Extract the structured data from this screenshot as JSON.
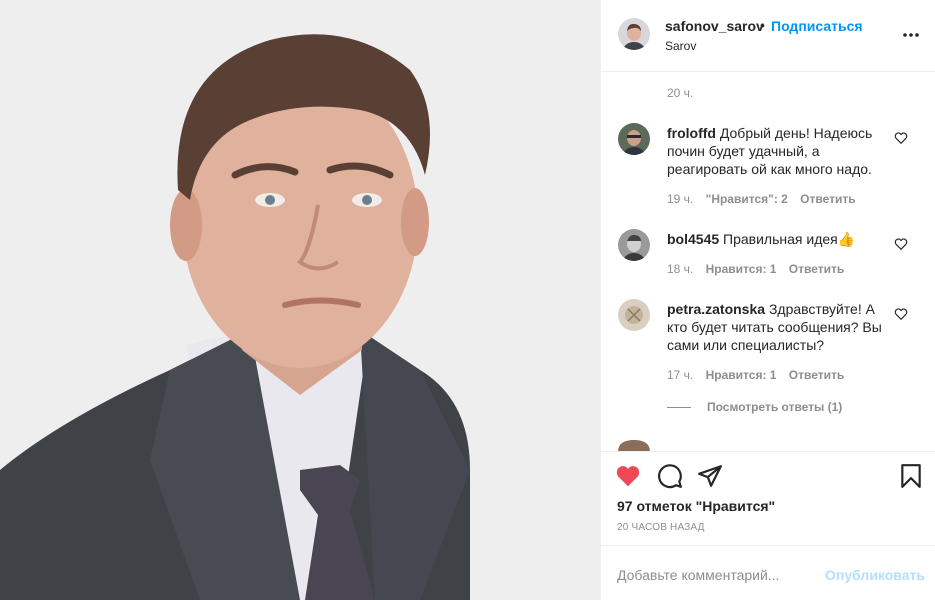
{
  "post": {
    "username": "safonov_sarov",
    "follow_label": "Подписаться",
    "location": "Sarov",
    "caption_time": "20 ч."
  },
  "comments": [
    {
      "user": "froloffd",
      "text": "Добрый день! Надеюсь почин будет удачный, а реагировать ой как много надо.",
      "time": "19 ч.",
      "likes": "\"Нравится\": 2",
      "reply": "Ответить"
    },
    {
      "user": "bol4545",
      "text": "Правильная идея👍",
      "time": "18 ч.",
      "likes": "Нравится: 1",
      "reply": "Ответить"
    },
    {
      "user": "petra.zatonska",
      "text": "Здравствуйте! А кто будет читать сообщения? Вы сами или специалисты?",
      "time": "17 ч.",
      "likes": "Нравится: 1",
      "reply": "Ответить"
    }
  ],
  "view_replies": "Посмотреть ответы (1)",
  "likes_count": "97 отметок \"Нравится\"",
  "posted_ago": "20 ЧАСОВ НАЗАД",
  "comment_box": {
    "placeholder": "Добавьте комментарий...",
    "post_label": "Опубликовать"
  },
  "colors": {
    "accent": "#0095f6",
    "liked": "#ed4956",
    "muted": "#8e8e8e"
  }
}
